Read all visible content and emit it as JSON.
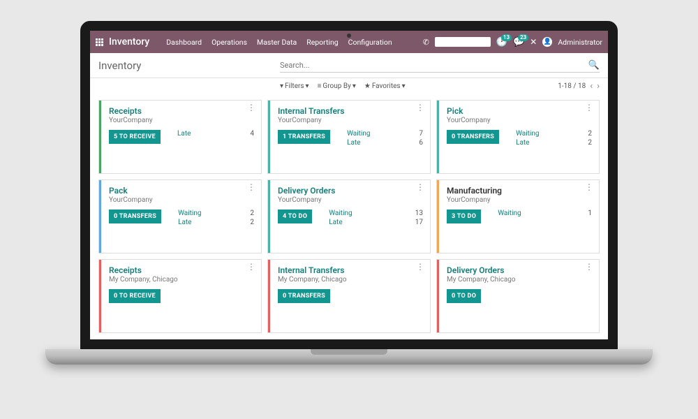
{
  "topbar": {
    "brand": "Inventory",
    "nav": [
      "Dashboard",
      "Operations",
      "Master Data",
      "Reporting",
      "Configuration"
    ],
    "badge1": "13",
    "badge2": "23",
    "user": "Administrator"
  },
  "page": {
    "title": "Inventory",
    "search_placeholder": "Search..."
  },
  "controls": {
    "filters": "Filters",
    "groupby": "Group By",
    "favorites": "Favorites",
    "pager": "1-18 / 18"
  },
  "cards": [
    {
      "title": "Receipts",
      "company": "YourCompany",
      "btn": "5 TO RECEIVE",
      "stripe": "c-green",
      "stats": [
        {
          "label": "Late",
          "val": "4"
        }
      ]
    },
    {
      "title": "Internal Transfers",
      "company": "YourCompany",
      "btn": "1 TRANSFERS",
      "stripe": "c-teal",
      "stats": [
        {
          "label": "Waiting",
          "val": "7"
        },
        {
          "label": "Late",
          "val": "6"
        }
      ]
    },
    {
      "title": "Pick",
      "company": "YourCompany",
      "btn": "0 TRANSFERS",
      "stripe": "c-teal",
      "stats": [
        {
          "label": "Waiting",
          "val": "2"
        },
        {
          "label": "Late",
          "val": "2"
        }
      ]
    },
    {
      "title": "Pack",
      "company": "YourCompany",
      "btn": "0 TRANSFERS",
      "stripe": "c-blue",
      "stats": [
        {
          "label": "Waiting",
          "val": "2"
        },
        {
          "label": "Late",
          "val": "2"
        }
      ]
    },
    {
      "title": "Delivery Orders",
      "company": "YourCompany",
      "btn": "4 TO DO",
      "stripe": "c-teal",
      "stats": [
        {
          "label": "Waiting",
          "val": "13"
        },
        {
          "label": "Late",
          "val": "17"
        }
      ]
    },
    {
      "title": "Manufacturing",
      "company": "YourCompany",
      "btn": "3 TO DO",
      "stripe": "c-orange",
      "titleBlack": true,
      "stats": [
        {
          "label": "Waiting",
          "val": "1"
        }
      ]
    },
    {
      "title": "Receipts",
      "company": "My Company, Chicago",
      "btn": "0 TO RECEIVE",
      "stripe": "c-red",
      "stats": []
    },
    {
      "title": "Internal Transfers",
      "company": "My Company, Chicago",
      "btn": "0 TRANSFERS",
      "stripe": "c-red",
      "stats": []
    },
    {
      "title": "Delivery Orders",
      "company": "My Company, Chicago",
      "btn": "0 TO DO",
      "stripe": "c-red",
      "stats": []
    }
  ]
}
